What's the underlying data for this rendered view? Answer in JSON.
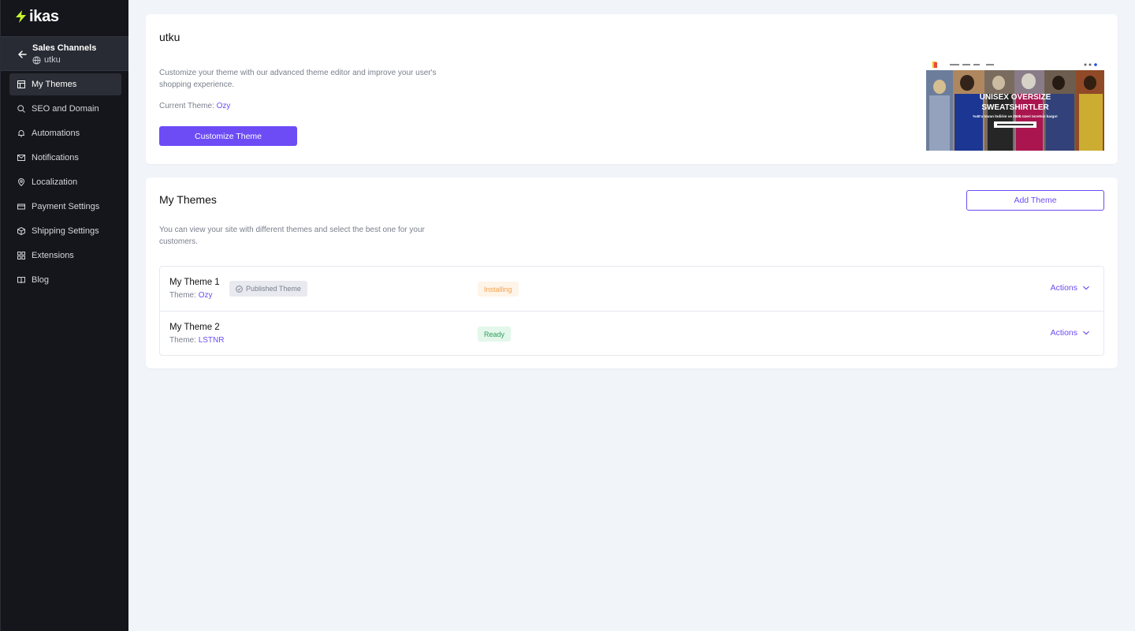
{
  "brand": {
    "name": "ikas",
    "accent": "#c6f432"
  },
  "sidebar": {
    "channel_title": "Sales Channels",
    "channel_name": "utku",
    "items": [
      {
        "label": "My Themes",
        "icon": "layout-icon",
        "active": true
      },
      {
        "label": "SEO and Domain",
        "icon": "search-icon"
      },
      {
        "label": "Automations",
        "icon": "bell-icon"
      },
      {
        "label": "Notifications",
        "icon": "mail-icon"
      },
      {
        "label": "Localization",
        "icon": "map-pin-icon"
      },
      {
        "label": "Payment Settings",
        "icon": "credit-card-icon"
      },
      {
        "label": "Shipping Settings",
        "icon": "box-icon"
      },
      {
        "label": "Extensions",
        "icon": "grid-icon"
      },
      {
        "label": "Blog",
        "icon": "book-icon"
      }
    ]
  },
  "store_card": {
    "title": "utku",
    "description": "Customize your theme with our advanced theme editor and improve your user's shopping experience.",
    "current_theme_label": "Current Theme:",
    "current_theme_value": "Ozy",
    "customize_button": "Customize Theme",
    "preview": {
      "headline_1": "UNISEX OVERSIZE",
      "headline_2": "SWEATSHIRTLER",
      "tagline": "%40'a Varan İndirim ve 250₺ üzeri ücretsiz kargo!"
    }
  },
  "themes_card": {
    "title": "My Themes",
    "add_button": "Add Theme",
    "description": "You can view your site with different themes and select the best one for your customers.",
    "themes": [
      {
        "name": "My Theme 1",
        "theme_label": "Theme:",
        "theme_value": "Ozy",
        "badge": "Published Theme",
        "status": "Installing",
        "actions": "Actions"
      },
      {
        "name": "My Theme 2",
        "theme_label": "Theme:",
        "theme_value": "LSTNR",
        "badge": "",
        "status": "Ready",
        "actions": "Actions"
      }
    ]
  },
  "colors": {
    "primary": "#6d4cf6",
    "sidebar_bg": "#14161c",
    "installing": "#f2a14b",
    "ready": "#2f9e5a"
  }
}
